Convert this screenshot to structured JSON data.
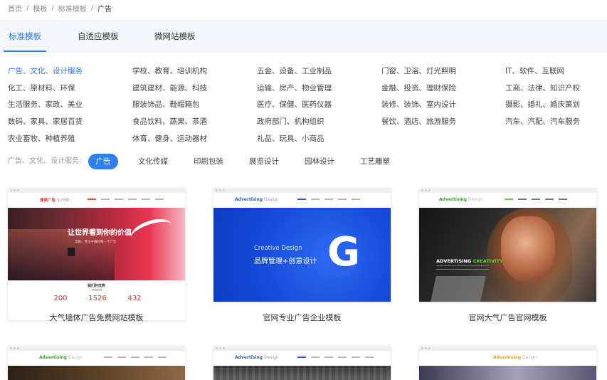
{
  "breadcrumb": [
    "首页",
    "模板",
    "标准模板",
    "广告"
  ],
  "tabs": [
    "标准模板",
    "自适应模板",
    "微网站模板"
  ],
  "categories": [
    [
      "广告、文化、设计服务",
      "学校、教育、培训机构",
      "五金、设备、工业制品",
      "门窗、卫浴、灯光照明",
      "IT、软件、互联网"
    ],
    [
      "化工、原材料、环保",
      "建筑建材、能源、科技",
      "运输、房产、物业管理",
      "金融、投资、理财保险",
      "工商、法律、知识产权"
    ],
    [
      "生活服务、家政、美业",
      "服装饰品、鞋帽箱包",
      "医疗、保健、医药仪器",
      "装修、装饰、室内设计",
      "摄影、婚礼、婚庆策划"
    ],
    [
      "数码、家具、家居百货",
      "食品饮料、蔬果、茶酒",
      "政府部门、机构组织",
      "餐饮、酒店、旅游服务",
      "汽车、汽配、汽车服务"
    ],
    [
      "农业畜牧、种植养殖",
      "体育、健身、运动器材",
      "礼品、玩具、小商品",
      "",
      ""
    ]
  ],
  "filter": {
    "label": "广告、文化、设计服务:",
    "pills": [
      "广告",
      "文化传媒",
      "印刷包装",
      "展览设计",
      "园林设计",
      "工艺雕塑"
    ]
  },
  "cards": [
    {
      "title": "大气墙体广告免费网站模板",
      "logo": "速美广告",
      "logo_sub": "SUMEI",
      "headline": "让世界看到你的价值",
      "subline": "奔跑，专注于做好每一个广告",
      "section": "我们的优势",
      "stats": [
        "200",
        "1526",
        "432"
      ]
    },
    {
      "title": "官网专业广告企业模板",
      "logo": "Advertising",
      "logo_sub": " Design",
      "en_text": "Creative Design",
      "cn_text": "品牌管理+创意设计",
      "letter": "G"
    },
    {
      "title": "官网大气广告官网模板",
      "logo": "Advertising",
      "logo_sub": " Design",
      "banner_a": "ADVERTISING ",
      "banner_b": "CREATIVITY"
    },
    {
      "logo": "Advertising",
      "logo_sub": " Design"
    },
    {
      "logo": "Advertising",
      "logo_sub": " Design"
    },
    {
      "logo": "Advertising",
      "logo_sub": " Design"
    }
  ],
  "colors": {
    "accent": "#2c7be5",
    "pill_active": "#2f80ed",
    "tabbar_bg": "#f3f6fb",
    "stat_red": "#d8342c",
    "brand_green": "#3aa52c"
  }
}
